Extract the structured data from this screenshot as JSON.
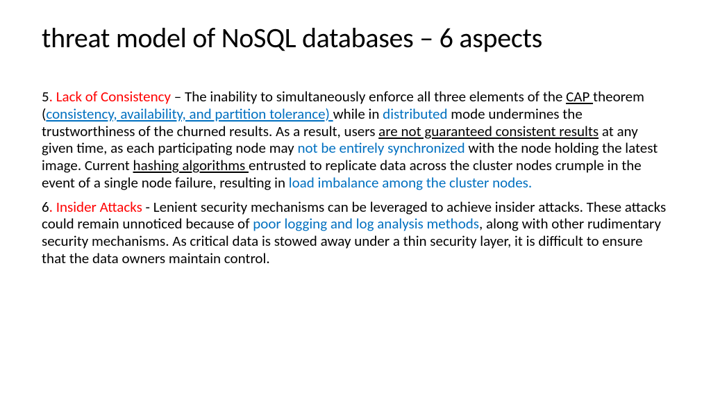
{
  "title": "threat model of NoSQL databases – 6 aspects",
  "p5": {
    "num": "5",
    "heading": ". Lack of Consistency",
    "t1": " – The inability to simultaneously enforce all three elements of the ",
    "cap": "CAP ",
    "t2": "theorem (",
    "cap_expand": "consistency, availability, and partition tolerance) ",
    "t3": "while in ",
    "distributed": "distributed",
    "t4": " mode undermines the trustworthiness of the churned results. As a result, users ",
    "notguar": "are not guaranteed consistent results",
    "t5": " at any given time, as each participating node may ",
    "sync": "not be entirely synchronized",
    "t6": " with the node holding the latest image. Current ",
    "hash": "hashing algorithms ",
    "t7": "entrusted to replicate data across the cluster nodes crumple in the event of a single node failure, resulting in ",
    "loadimb": "load imbalance among the cluster nodes."
  },
  "p6": {
    "num": "6",
    "heading": ". Insider Attacks",
    "t1": " - Lenient security mechanisms can be leveraged to achieve insider attacks. These attacks could remain unnoticed because of ",
    "poorlog": "poor logging and log analysis methods",
    "t2": ", along with other rudimentary security mechanisms. As critical data is stowed away under a thin security layer, it is difficult to ensure that the data owners maintain control."
  }
}
